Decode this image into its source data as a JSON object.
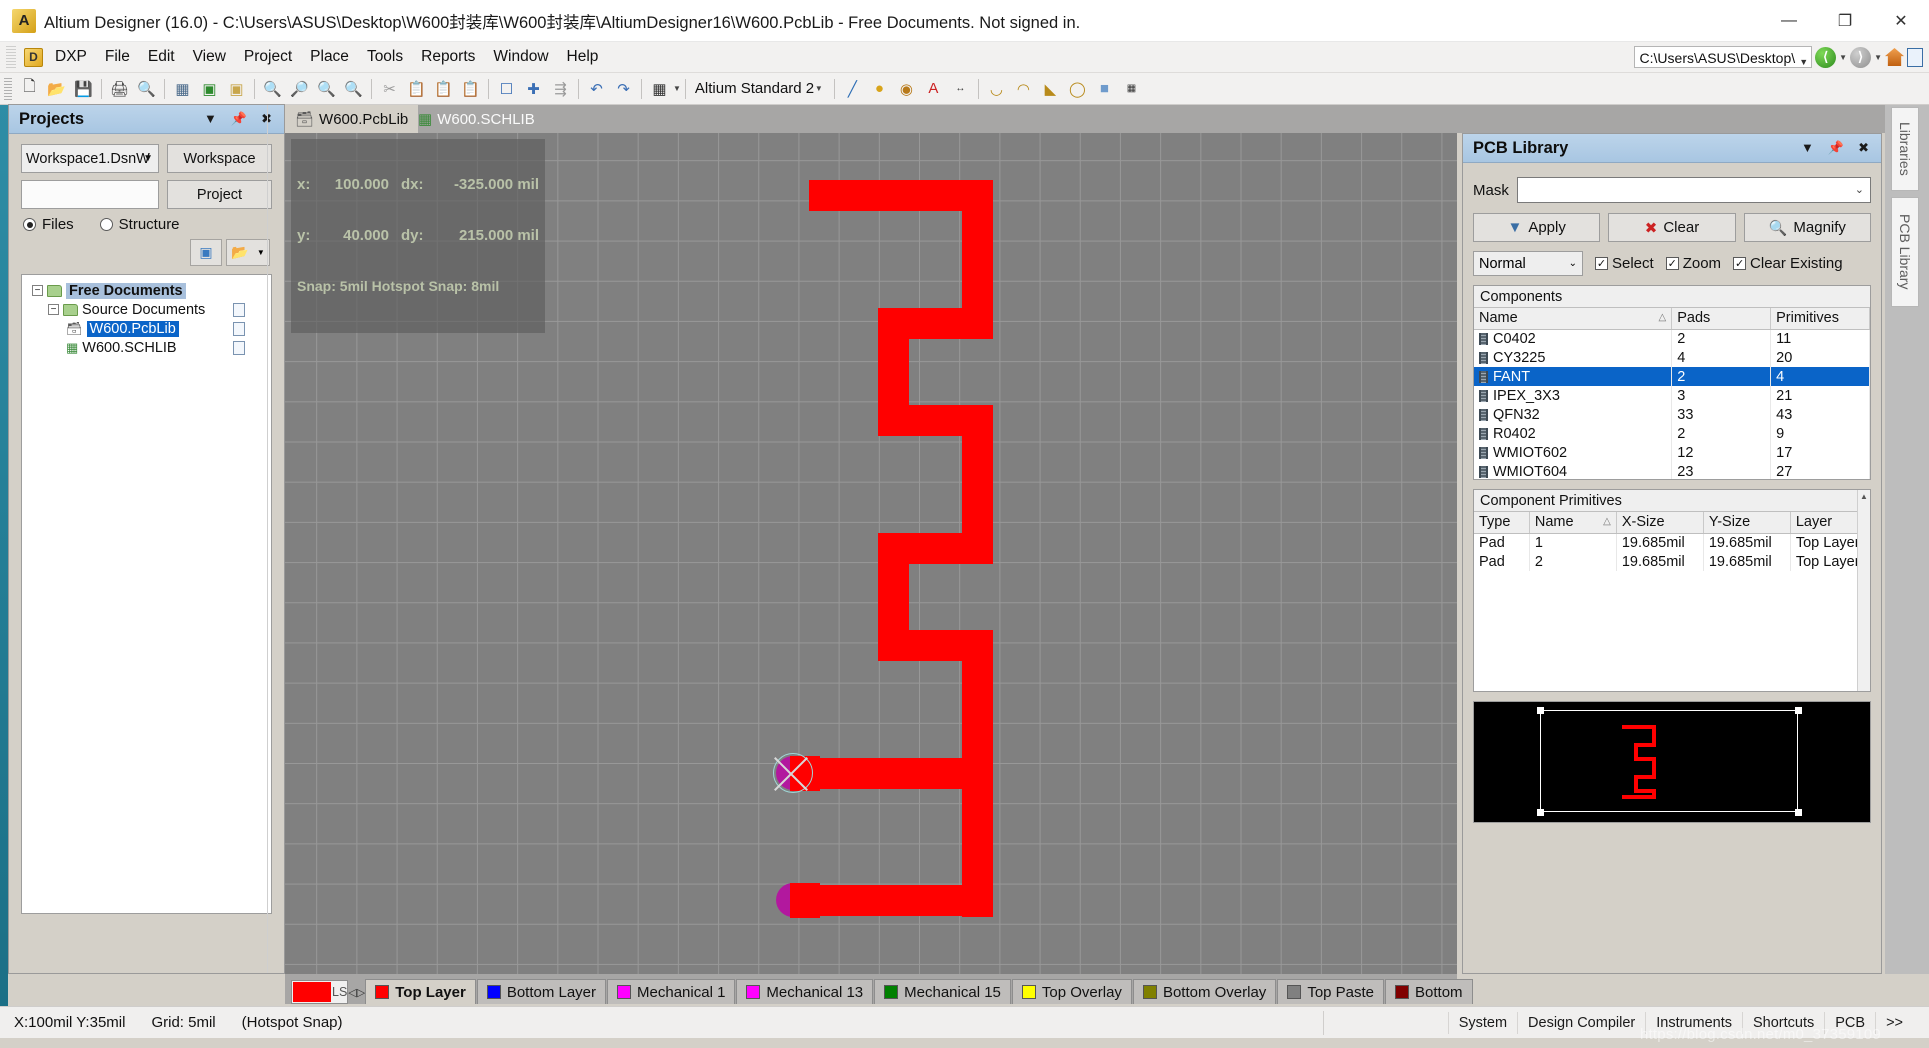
{
  "window": {
    "title": "Altium Designer (16.0) - C:\\Users\\ASUS\\Desktop\\W600封装库\\W600封装库\\AltiumDesigner16\\W600.PcbLib - Free Documents. Not signed in.",
    "logo_icon": "altium-logo-icon",
    "minimize": "—",
    "maximize": "❐",
    "close": "✕"
  },
  "menubar": {
    "dxp_label": "DXP",
    "items": [
      "File",
      "Edit",
      "View",
      "Project",
      "Place",
      "Tools",
      "Reports",
      "Window",
      "Help"
    ],
    "path_value": "C:\\Users\\ASUS\\Desktop\\",
    "nav_back_icon": "back-arrow-icon",
    "nav_forward_icon": "forward-arrow-icon",
    "home_icon": "home-icon",
    "doc_icon": "document-icon"
  },
  "toolbar": {
    "style_value": "Altium Standard 2",
    "icons": [
      "new-document-icon",
      "open-folder-icon",
      "save-icon",
      "print-icon",
      "print-preview-icon",
      "board-3d-icon",
      "pcb-icon",
      "window-icon",
      "zoom-in-icon",
      "zoom-out-icon",
      "zoom-area-icon",
      "zoom-selected-icon",
      "cut-icon",
      "copy-icon",
      "paste-icon",
      "paste-special-icon",
      "select-area-icon",
      "move-icon",
      "align-icon",
      "undo-icon",
      "redo-icon",
      "grid-icon"
    ],
    "right_icons": [
      "line-icon",
      "pad-icon",
      "via-icon",
      "string-icon",
      "dimension-icon",
      "arc-center-icon",
      "arc-edge-icon",
      "arc-any-icon",
      "full-circle-icon",
      "fill-icon",
      "component-icon"
    ]
  },
  "document_tabs": [
    {
      "label": "W600.PcbLib",
      "icon": "pcblib-icon",
      "active": true
    },
    {
      "label": "W600.SCHLIB",
      "icon": "schlib-icon",
      "active": false
    }
  ],
  "projects_panel": {
    "title": "Projects",
    "menu_icon": "chevron-down-icon",
    "pin_icon": "pin-icon",
    "close_icon": "close-icon",
    "workspace_value": "Workspace1.DsnW",
    "workspace_button": "Workspace",
    "project_value": "",
    "project_button": "Project",
    "view_mode": [
      {
        "label": "Files",
        "selected": true
      },
      {
        "label": "Structure",
        "selected": false
      }
    ],
    "toolbar_icons": [
      "compile-icon",
      "open-project-icon",
      "dropdown-caret-icon"
    ],
    "tree": [
      {
        "label": "Free Documents",
        "level": 0,
        "icon": "folder-icon",
        "expanded": true,
        "state": "band"
      },
      {
        "label": "Source Documents",
        "level": 1,
        "icon": "folder-icon",
        "expanded": true,
        "state": "none"
      },
      {
        "label": "W600.PcbLib",
        "level": 2,
        "icon": "pcblib-icon",
        "expanded": false,
        "state": "selected"
      },
      {
        "label": "W600.SCHLIB",
        "level": 2,
        "icon": "schlib-icon",
        "expanded": false,
        "state": "none"
      }
    ]
  },
  "canvas": {
    "coord": {
      "x_label": "x:",
      "x_value": "100.000",
      "dx_label": "dx:",
      "dx_value": "-325.000 mil",
      "y_label": "y:",
      "y_value": "40.000",
      "dy_label": "dy:",
      "dy_value": "215.000 mil",
      "snap": "Snap: 5mil Hotspot Snap: 8mil"
    },
    "track_color": "#ff0000",
    "pad_color": "#b2189e",
    "background": "#808080"
  },
  "pcb_library_panel": {
    "title": "PCB Library",
    "menu_icon": "chevron-down-icon",
    "pin_icon": "pin-icon",
    "close_icon": "close-icon",
    "mask_label": "Mask",
    "mask_value": "",
    "buttons": [
      {
        "label": "Apply",
        "icon": "filter-icon"
      },
      {
        "label": "Clear",
        "icon": "clear-filter-icon"
      },
      {
        "label": "Magnify",
        "icon": "magnify-icon"
      }
    ],
    "mode_value": "Normal",
    "options": [
      {
        "label": "Select",
        "checked": true
      },
      {
        "label": "Zoom",
        "checked": true
      },
      {
        "label": "Clear Existing",
        "checked": true
      }
    ],
    "components": {
      "caption": "Components",
      "columns": [
        "Name",
        "Pads",
        "Primitives"
      ],
      "sort_column": "Name",
      "rows": [
        {
          "name": "C0402",
          "pads": "2",
          "primitives": "11",
          "selected": false
        },
        {
          "name": "CY3225",
          "pads": "4",
          "primitives": "20",
          "selected": false
        },
        {
          "name": "FANT",
          "pads": "2",
          "primitives": "4",
          "selected": true
        },
        {
          "name": "IPEX_3X3",
          "pads": "3",
          "primitives": "21",
          "selected": false
        },
        {
          "name": "QFN32",
          "pads": "33",
          "primitives": "43",
          "selected": false
        },
        {
          "name": "R0402",
          "pads": "2",
          "primitives": "9",
          "selected": false
        },
        {
          "name": "WMIOT602",
          "pads": "12",
          "primitives": "17",
          "selected": false
        },
        {
          "name": "WMIOT604",
          "pads": "23",
          "primitives": "27",
          "selected": false
        }
      ]
    },
    "component_primitives": {
      "caption": "Component Primitives",
      "columns": [
        "Type",
        "Name",
        "X-Size",
        "Y-Size",
        "Layer"
      ],
      "sort_column": "Name",
      "rows": [
        {
          "type": "Pad",
          "name": "1",
          "x_size": "19.685mil",
          "y_size": "19.685mil",
          "layer": "Top Layer"
        },
        {
          "type": "Pad",
          "name": "2",
          "x_size": "19.685mil",
          "y_size": "19.685mil",
          "layer": "Top Layer"
        }
      ]
    }
  },
  "vertical_tabs": [
    "Libraries",
    "PCB Library"
  ],
  "layer_bar": {
    "swatch_color": "#ff0000",
    "ls_label": "LS",
    "prev_icon": "chevron-left-icon",
    "next_icon": "chevron-right-icon",
    "layers": [
      {
        "label": "Top Layer",
        "color": "#ff0000",
        "active": true
      },
      {
        "label": "Bottom Layer",
        "color": "#0000ff",
        "active": false
      },
      {
        "label": "Mechanical 1",
        "color": "#ff00ff",
        "active": false
      },
      {
        "label": "Mechanical 13",
        "color": "#ff00ff",
        "active": false
      },
      {
        "label": "Mechanical 15",
        "color": "#008000",
        "active": false
      },
      {
        "label": "Top Overlay",
        "color": "#ffff00",
        "active": false
      },
      {
        "label": "Bottom Overlay",
        "color": "#808000",
        "active": false
      },
      {
        "label": "Top Paste",
        "color": "#808080",
        "active": false
      },
      {
        "label": "Bottom",
        "color": "#800000",
        "active": false
      }
    ]
  },
  "statusbar": {
    "coords": "X:100mil Y:35mil",
    "grid": "Grid: 5mil",
    "mode": "(Hotspot Snap)",
    "buttons": [
      "System",
      "Design Compiler",
      "Instruments",
      "Shortcuts",
      "PCB",
      ">>"
    ],
    "watermark": "https://blog.csdn.net/m0_37359109"
  }
}
